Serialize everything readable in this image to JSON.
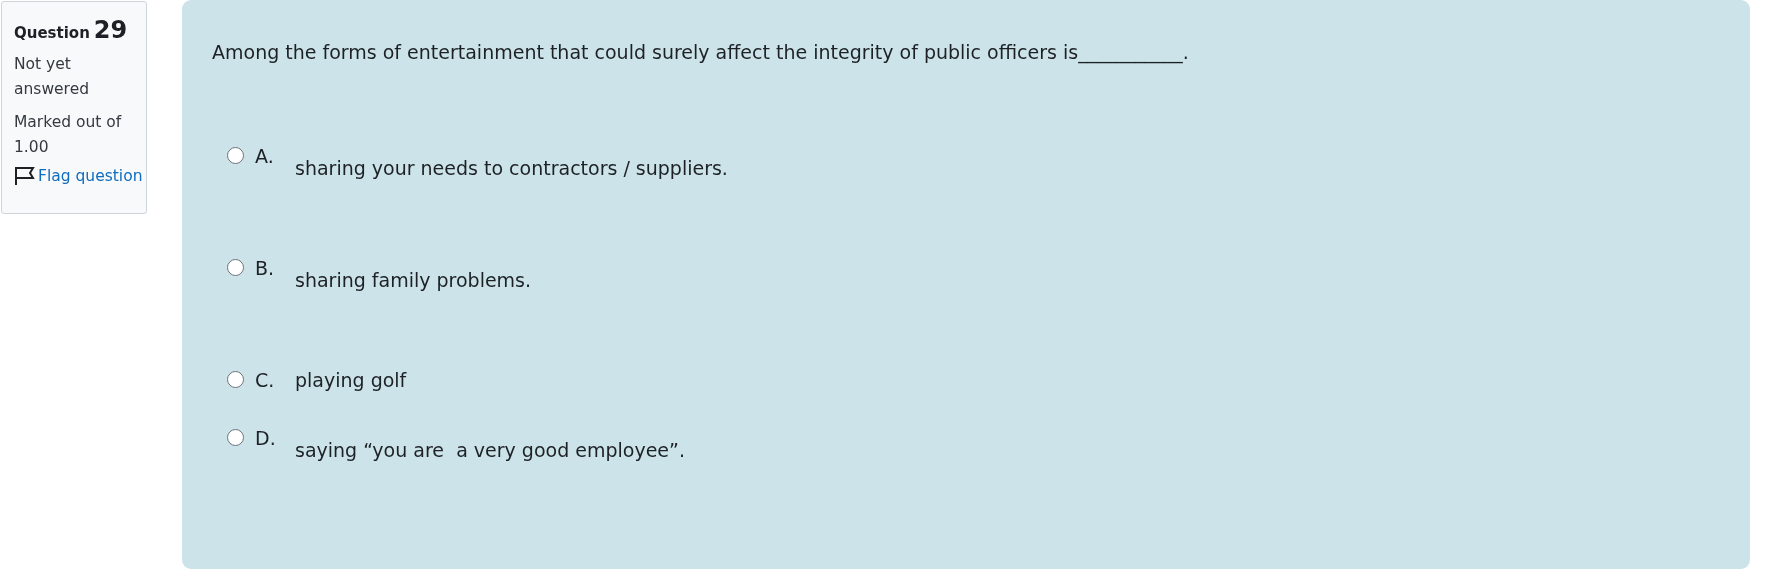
{
  "info": {
    "label": "Question",
    "number": "29",
    "status": "Not yet answered",
    "marks": "Marked out of 1.00",
    "flag_link": "Flag question"
  },
  "question": {
    "text": "Among the forms of entertainment that could surely affect the integrity of public officers is___________.",
    "options": [
      {
        "letter": "A.",
        "text": "sharing your needs to contractors / suppliers.",
        "selected": false
      },
      {
        "letter": "B.",
        "text": "sharing family problems.",
        "selected": false
      },
      {
        "letter": "C.",
        "text": "playing golf",
        "selected": false
      },
      {
        "letter": "D.",
        "text": "saying “you are  a very good employee”.",
        "selected": false
      }
    ]
  }
}
